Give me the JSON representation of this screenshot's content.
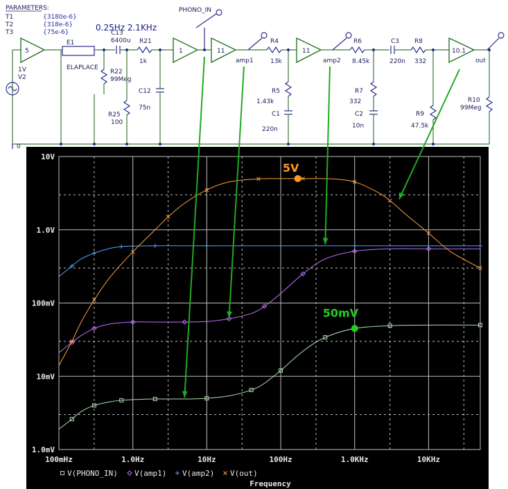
{
  "schematic": {
    "params_title": "PARAMETERS:",
    "params": [
      {
        "name": "T1",
        "value": "{3180e-6}"
      },
      {
        "name": "T2",
        "value": "{318e-6}"
      },
      {
        "name": "T3",
        "value": "{75e-6}"
      }
    ],
    "hp_label": "0.25Hz 2.1KHz",
    "gains": [
      "5",
      "1",
      "11",
      "11",
      "10.1"
    ],
    "source_labels": [
      "1V",
      "V2"
    ],
    "laplace_labels": [
      "E1",
      "ELAPLACE"
    ],
    "nets": [
      "PHONO_IN",
      "amp1",
      "amp2",
      "out"
    ],
    "components": [
      {
        "name": "C13",
        "value": "6400u"
      },
      {
        "name": "R21",
        "value": "1k"
      },
      {
        "name": "R22",
        "value": "99Meg"
      },
      {
        "name": "R25",
        "value": "100"
      },
      {
        "name": "C12",
        "value": "75n"
      },
      {
        "name": "R4",
        "value": "13k"
      },
      {
        "name": "R5",
        "value": "1.43k"
      },
      {
        "name": "C1",
        "value": "220n"
      },
      {
        "name": "R6",
        "value": "8.45k"
      },
      {
        "name": "R7",
        "value": "332"
      },
      {
        "name": "C2",
        "value": "10n"
      },
      {
        "name": "C3",
        "value": "220n"
      },
      {
        "name": "R8",
        "value": "332"
      },
      {
        "name": "R9",
        "value": "47.5k"
      },
      {
        "name": "R10",
        "value": "99Meg"
      }
    ],
    "ground_label": "0"
  },
  "annotations": {
    "five_v": "5V",
    "fifty_mv": "50mV"
  },
  "colors": {
    "plot_bg": "#000000",
    "grid": "#c0c0c0",
    "phono": "#b4ddb4",
    "amp1": "#c070ff",
    "amp2": "#50a8ff",
    "out": "#ffa040",
    "annot_orange": "#ff9a20",
    "annot_green": "#22cc22",
    "arrow": "#22aa22"
  },
  "chart_data": {
    "type": "line",
    "xscale": "log",
    "yscale": "log",
    "xlim": [
      0.1,
      50000
    ],
    "ylim": [
      0.001,
      10
    ],
    "grid": true,
    "xlabel": "Frequency",
    "xticks": [
      "100mHz",
      "1.0Hz",
      "10Hz",
      "100Hz",
      "1.0KHz",
      "10KHz"
    ],
    "yticks": [
      "10V",
      "1.0V",
      "100mV",
      "10mV",
      "1.0mV"
    ],
    "legend_position": "bottom-left",
    "series": [
      {
        "name": "V(PHONO_IN)",
        "marker": "square",
        "x": [
          0.1,
          0.15,
          0.2,
          0.3,
          0.5,
          0.7,
          1,
          2,
          5,
          10,
          20,
          40,
          60,
          100,
          200,
          400,
          1000,
          3000,
          10000,
          50000
        ],
        "y": [
          0.0019,
          0.0026,
          0.0033,
          0.004,
          0.0045,
          0.0047,
          0.0048,
          0.0049,
          0.0049,
          0.005,
          0.0054,
          0.0065,
          0.008,
          0.012,
          0.022,
          0.034,
          0.045,
          0.049,
          0.05,
          0.05
        ]
      },
      {
        "name": "V(amp1)",
        "marker": "diamond",
        "x": [
          0.1,
          0.15,
          0.2,
          0.3,
          0.5,
          1,
          2,
          5,
          10,
          20,
          40,
          60,
          100,
          200,
          400,
          1000,
          3000,
          10000,
          50000
        ],
        "y": [
          0.021,
          0.029,
          0.036,
          0.045,
          0.052,
          0.055,
          0.055,
          0.055,
          0.056,
          0.061,
          0.072,
          0.09,
          0.135,
          0.25,
          0.4,
          0.51,
          0.55,
          0.55,
          0.55
        ]
      },
      {
        "name": "V(amp2)",
        "marker": "plus",
        "x": [
          0.1,
          0.15,
          0.2,
          0.3,
          0.5,
          0.7,
          1,
          2,
          5,
          10,
          100,
          1000,
          10000,
          50000
        ],
        "y": [
          0.23,
          0.32,
          0.4,
          0.48,
          0.56,
          0.59,
          0.6,
          0.605,
          0.605,
          0.605,
          0.605,
          0.605,
          0.605,
          0.605
        ]
      },
      {
        "name": "V(out)",
        "marker": "x",
        "x": [
          0.1,
          0.15,
          0.2,
          0.3,
          0.5,
          1,
          2,
          3,
          5,
          10,
          20,
          50,
          100,
          200,
          500,
          1000,
          2000,
          3000,
          5000,
          10000,
          20000,
          50000
        ],
        "y": [
          0.014,
          0.03,
          0.055,
          0.11,
          0.23,
          0.5,
          1.0,
          1.5,
          2.3,
          3.5,
          4.5,
          4.95,
          5.0,
          5.0,
          4.95,
          4.5,
          3.3,
          2.5,
          1.6,
          0.9,
          0.5,
          0.3
        ]
      }
    ]
  }
}
